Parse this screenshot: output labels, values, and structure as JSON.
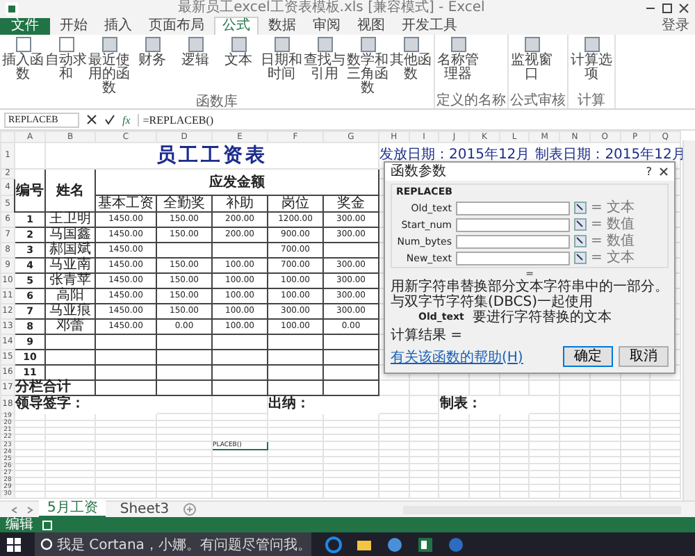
{
  "window": {
    "title": "最新员工excel工资表模板.xls [兼容模式] - Excel",
    "login": "登录"
  },
  "tabs": [
    {
      "label": "文件",
      "selected": false
    },
    {
      "label": "开始",
      "selected": false
    },
    {
      "label": "插入",
      "selected": false
    },
    {
      "label": "页面布局",
      "selected": false
    },
    {
      "label": "公式",
      "selected": true
    },
    {
      "label": "数据",
      "selected": false
    },
    {
      "label": "审阅",
      "selected": false
    },
    {
      "label": "视图",
      "selected": false
    },
    {
      "label": "开发工具",
      "selected": false
    }
  ],
  "ribbon": [
    {
      "label": "函数库",
      "buttons": [
        "插入函数",
        "自动求和",
        "最近使用的函数",
        "财务",
        "逻辑",
        "文本",
        "日期和时间",
        "查找与引用",
        "数学和三角函数",
        "其他函数"
      ]
    },
    {
      "label": "定义的名称",
      "buttons": [
        "名称管理器"
      ]
    },
    {
      "label": "公式审核",
      "buttons": [
        "监视窗口"
      ]
    },
    {
      "label": "计算",
      "buttons": [
        "计算选项"
      ]
    }
  ],
  "name_box": "REPLACEB",
  "fx_label": "fx",
  "formula": "=REPLACEB()",
  "columns": [
    "A",
    "B",
    "C",
    "D",
    "E",
    "F",
    "G",
    "H",
    "I",
    "J",
    "K",
    "L",
    "M",
    "N",
    "O",
    "P",
    "Q"
  ],
  "sheet": {
    "title": "员工工资表",
    "dates": [
      "发放日期：2015年12月",
      "制表日期：2015年12月"
    ],
    "number_header": "编号",
    "name_header": "姓名",
    "group_header": "应发金额",
    "subheaders": [
      "基本工资",
      "全勤奖",
      "补助",
      "岗位",
      "奖金"
    ],
    "rows": [
      {
        "no": "1",
        "name": "王卫明",
        "values": [
          {
            "text": "1450.00"
          },
          {
            "text": "150.00"
          },
          {
            "text": "200.00"
          },
          {
            "text": "1200.00"
          },
          {
            "text": "300.00"
          }
        ]
      },
      {
        "no": "2",
        "name": "马国鑫",
        "values": [
          {
            "text": "1450.00"
          },
          {
            "text": "150.00"
          },
          {
            "text": "200.00"
          },
          {
            "text": "900.00"
          },
          {
            "text": "300.00"
          }
        ]
      },
      {
        "no": "3",
        "name": "郝国斌",
        "values": [
          {
            "text": "1450.00"
          },
          {
            "blank": true
          },
          {
            "blank": true
          },
          {
            "text": "700.00"
          },
          {
            "blank": true
          }
        ]
      },
      {
        "no": "4",
        "name": "马亚南",
        "values": [
          {
            "text": "1450.00"
          },
          {
            "text": "150.00"
          },
          {
            "text": "100.00"
          },
          {
            "text": "700.00"
          },
          {
            "text": "300.00"
          }
        ]
      },
      {
        "no": "5",
        "name": "张青苹",
        "values": [
          {
            "text": "1450.00"
          },
          {
            "text": "150.00"
          },
          {
            "text": "100.00"
          },
          {
            "text": "100.00"
          },
          {
            "text": "300.00"
          }
        ]
      },
      {
        "no": "6",
        "name": "高阳",
        "values": [
          {
            "text": "1450.00"
          },
          {
            "text": "150.00"
          },
          {
            "text": "100.00"
          },
          {
            "text": "100.00"
          },
          {
            "text": "300.00"
          }
        ]
      },
      {
        "no": "7",
        "name": "马亚痕",
        "values": [
          {
            "text": "1450.00"
          },
          {
            "text": "150.00"
          },
          {
            "text": "100.00"
          },
          {
            "text": "300.00"
          },
          {
            "text": "300.00"
          }
        ]
      },
      {
        "no": "8",
        "name": "邓蕾",
        "values": [
          {
            "text": "1450.00"
          },
          {
            "text": "0.00"
          },
          {
            "text": "100.00"
          },
          {
            "text": "100.00"
          },
          {
            "text": "0.00"
          }
        ]
      }
    ],
    "empty_rows": [
      "9",
      "10",
      "11"
    ],
    "total_label": "分栏合计",
    "signatures": [
      "领导签字：",
      "出纳：",
      "制表："
    ],
    "editing_cell": "PLACEB()"
  },
  "row_numbers": {
    "head": [
      "1",
      "2",
      "4",
      "5"
    ],
    "body": [
      "6",
      "7",
      "8",
      "9",
      "10",
      "11",
      "12",
      "13",
      "14",
      "15",
      "16",
      "17",
      "18"
    ],
    "tail": [
      "19",
      "20",
      "21",
      "22",
      "23",
      "24",
      "25",
      "26",
      "27",
      "28",
      "29",
      "30"
    ]
  },
  "dialog": {
    "title": "函数参数",
    "help": "?",
    "function": "REPLACEB",
    "args": [
      {
        "name": "Old_text",
        "result": "= 文本"
      },
      {
        "name": "Start_num",
        "result": "= 数值"
      },
      {
        "name": "Num_bytes",
        "result": "= 数值"
      },
      {
        "name": "New_text",
        "result": "= 文本"
      }
    ],
    "equals": "=",
    "description": "用新字符串替换部分文本字符串中的一部分。与双字节字符集(DBCS)一起使用",
    "arg_name": "Old_text",
    "arg_description": "要进行字符替换的文本",
    "result_label": "计算结果 =",
    "help_link": "有关该函数的帮助(H)",
    "buttons": [
      "确定",
      "取消"
    ]
  },
  "sheet_tabs": [
    {
      "label": "5月工资",
      "selected": true
    },
    {
      "label": "Sheet3",
      "selected": false
    }
  ],
  "status": "编辑",
  "taskbar": {
    "search": "我是 Cortana，小娜。有问题尽管问我。"
  }
}
